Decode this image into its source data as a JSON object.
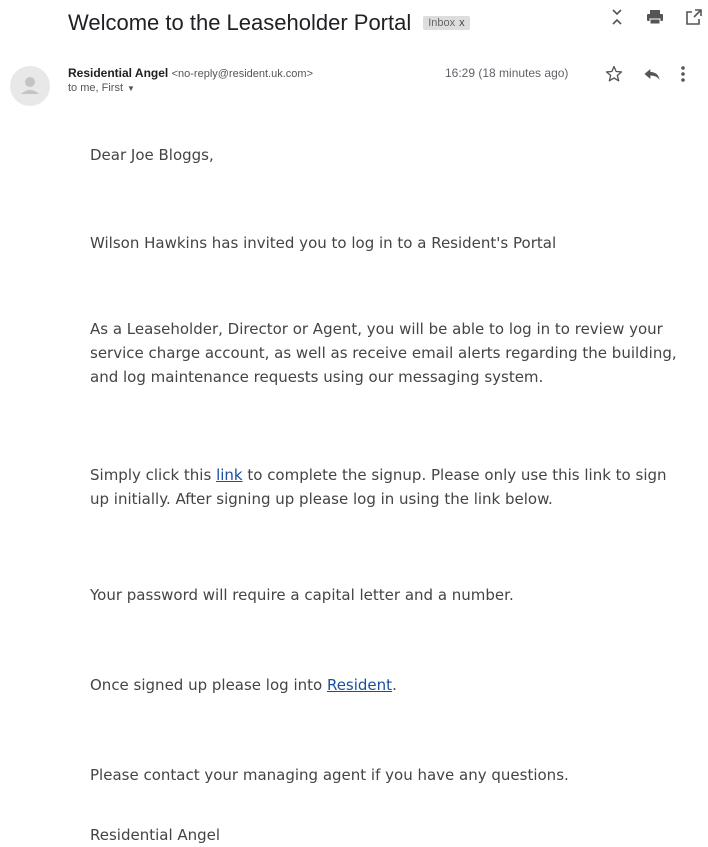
{
  "subject": "Welcome to the Leaseholder Portal",
  "label_chip": {
    "label": "Inbox",
    "close": "x"
  },
  "sender": {
    "name": "Residential Angel",
    "email": "<no-reply@resident.uk.com>"
  },
  "recipients": "to me, First",
  "timestamp": "16:29 (18 minutes ago)",
  "body": {
    "greeting": "Dear Joe Bloggs,",
    "invite": "Wilson Hawkins has invited you to log in to a Resident's Portal",
    "description": "As a Leaseholder, Director or Agent, you will be able to log in to review your service charge account, as well as receive email alerts regarding the building, and log maintenance requests using our messaging system.",
    "signup_before": "Simply click this ",
    "signup_link": "link",
    "signup_after": " to complete the signup. Please only use this link to sign up initially. After signing up please log in using the link below.",
    "password_note": "Your password will require a capital letter and a number.",
    "login_before": "Once signed up please log into ",
    "login_link": "Resident",
    "login_after": ".",
    "contact": "Please contact your managing agent if you have any questions.",
    "signoff": "Residential Angel"
  },
  "icons": {
    "collapse": "expand-collapse-icon",
    "print": "print-icon",
    "popout": "new-window-icon",
    "star": "star-icon",
    "reply": "reply-icon",
    "more": "more-vert-icon",
    "avatar": "avatar-person-icon"
  }
}
